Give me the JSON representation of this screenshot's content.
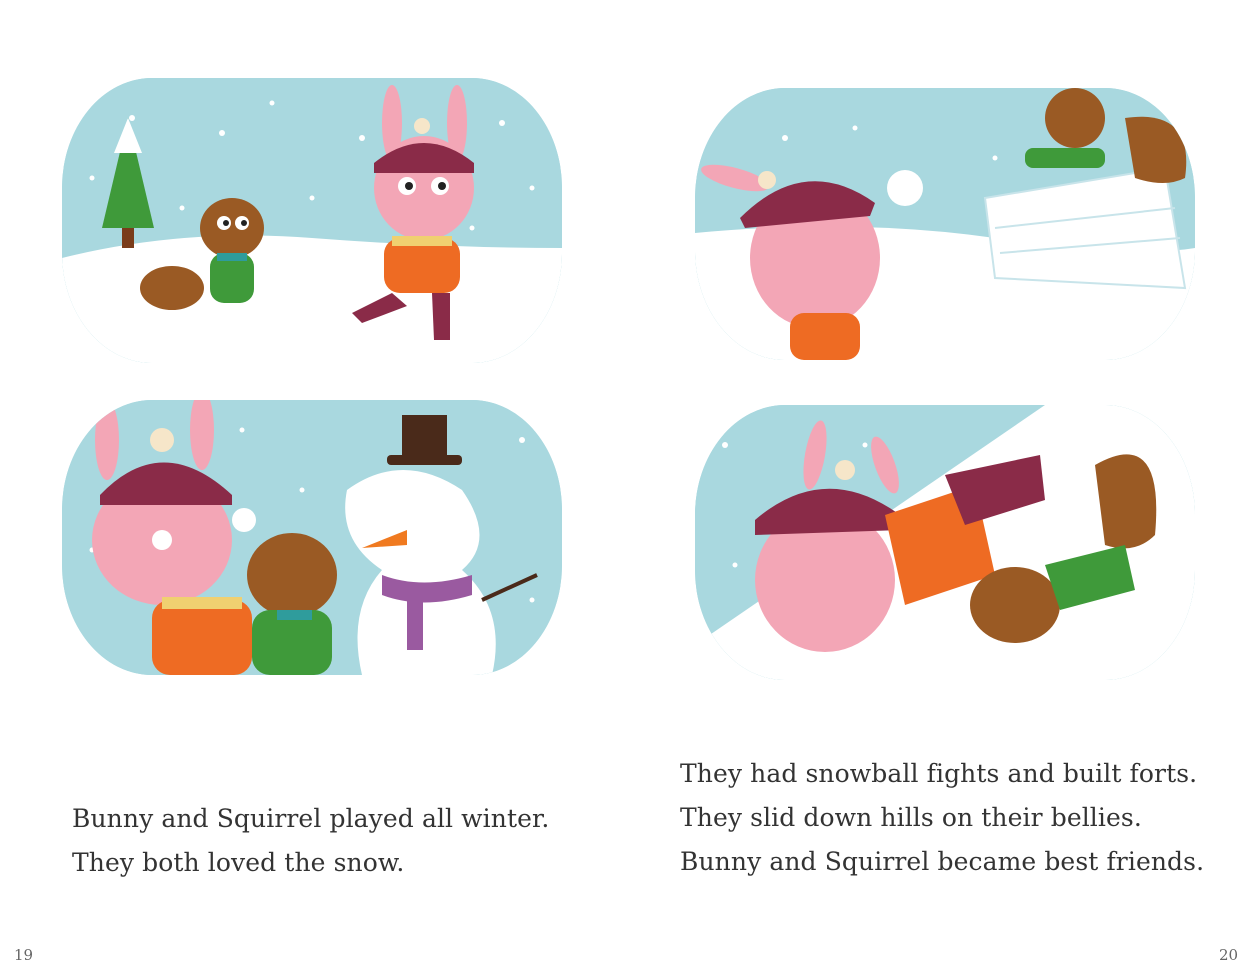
{
  "pages": {
    "left": {
      "number": "19",
      "lines": [
        "Bunny and Squirrel played all winter.",
        "They both loved the snow."
      ]
    },
    "right": {
      "number": "20",
      "lines": [
        "They had snowball fights and built forts.",
        "They slid down hills on their bellies.",
        "Bunny and Squirrel became best friends."
      ]
    }
  },
  "colors": {
    "sky": "#a9d8df",
    "snow": "#ffffff",
    "bunny_pink": "#f3a6b6",
    "hat": "#8a2b48",
    "jacket": "#ee6b23",
    "squirrel_brown": "#9a5a24",
    "scarf_green": "#2f9c9c",
    "tree_green": "#3f9a3a",
    "hat_black": "#4a2a1a",
    "carrot": "#f07a20",
    "scarf_purple": "#9a5aa0"
  }
}
